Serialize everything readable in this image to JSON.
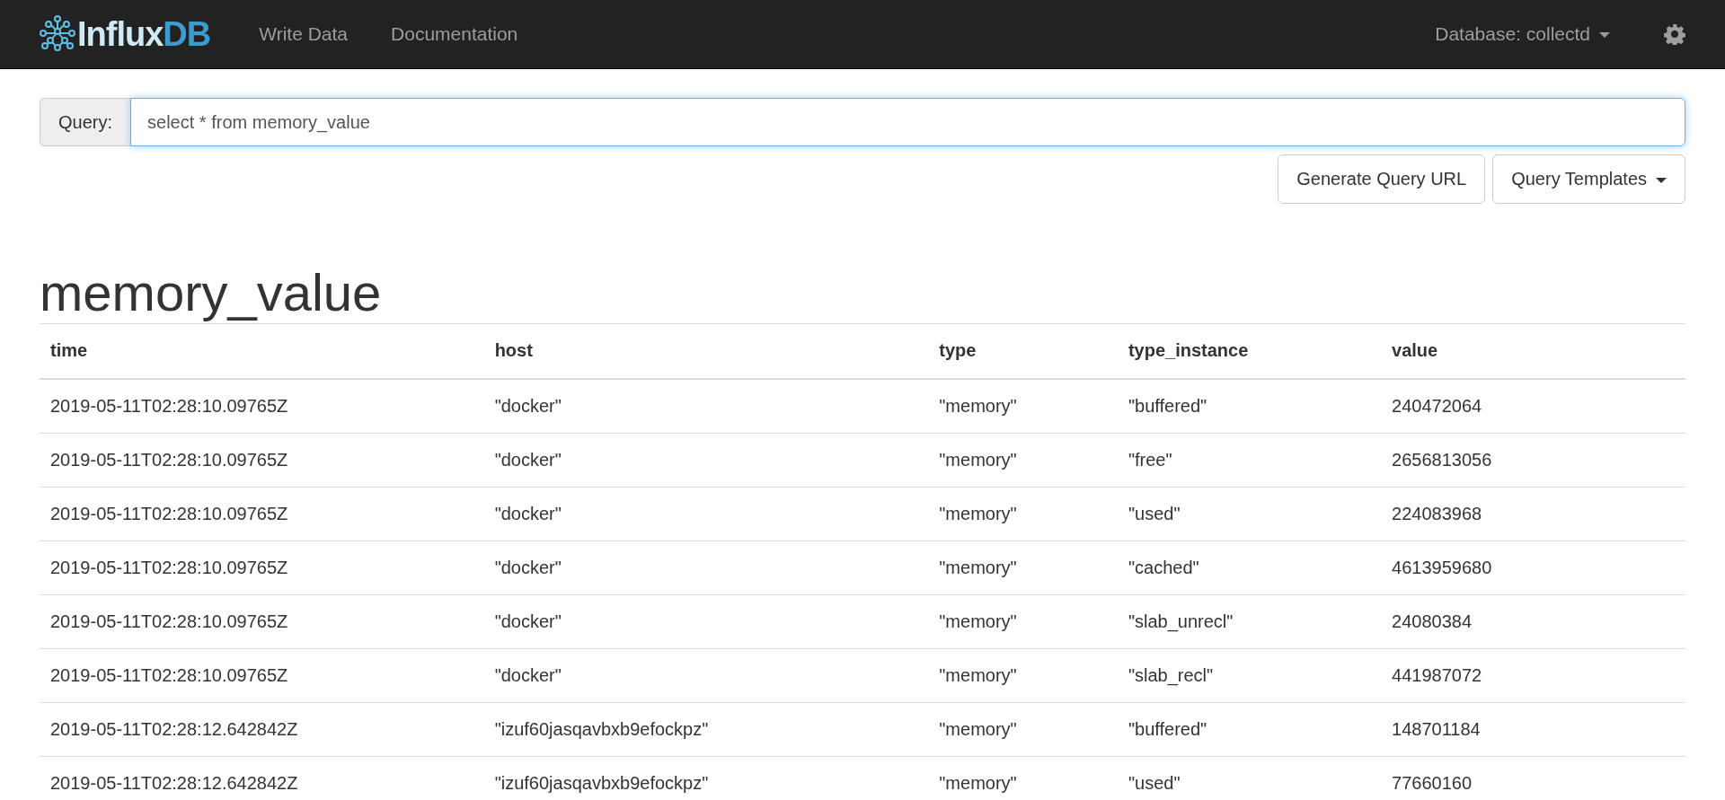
{
  "navbar": {
    "brand_main": "Influx",
    "brand_accent": "DB",
    "links": [
      "Write Data",
      "Documentation"
    ],
    "database_menu": "Database: collectd"
  },
  "query": {
    "label": "Query:",
    "value": "select * from memory_value"
  },
  "buttons": [
    {
      "label": "Generate Query URL",
      "kind": "plain"
    },
    {
      "label": "Query Templates",
      "kind": "dropdown"
    }
  ],
  "series_title": "memory_value",
  "table": {
    "columns": [
      "time",
      "host",
      "type",
      "type_instance",
      "value"
    ],
    "rows": [
      [
        "2019-05-11T02:28:10.09765Z",
        "\"docker\"",
        "\"memory\"",
        "\"buffered\"",
        "240472064"
      ],
      [
        "2019-05-11T02:28:10.09765Z",
        "\"docker\"",
        "\"memory\"",
        "\"free\"",
        "2656813056"
      ],
      [
        "2019-05-11T02:28:10.09765Z",
        "\"docker\"",
        "\"memory\"",
        "\"used\"",
        "224083968"
      ],
      [
        "2019-05-11T02:28:10.09765Z",
        "\"docker\"",
        "\"memory\"",
        "\"cached\"",
        "4613959680"
      ],
      [
        "2019-05-11T02:28:10.09765Z",
        "\"docker\"",
        "\"memory\"",
        "\"slab_unrecl\"",
        "24080384"
      ],
      [
        "2019-05-11T02:28:10.09765Z",
        "\"docker\"",
        "\"memory\"",
        "\"slab_recl\"",
        "441987072"
      ],
      [
        "2019-05-11T02:28:12.642842Z",
        "\"izuf60jasqavbxb9efockpz\"",
        "\"memory\"",
        "\"buffered\"",
        "148701184"
      ],
      [
        "2019-05-11T02:28:12.642842Z",
        "\"izuf60jasqavbxb9efockpz\"",
        "\"memory\"",
        "\"used\"",
        "77660160"
      ]
    ]
  }
}
